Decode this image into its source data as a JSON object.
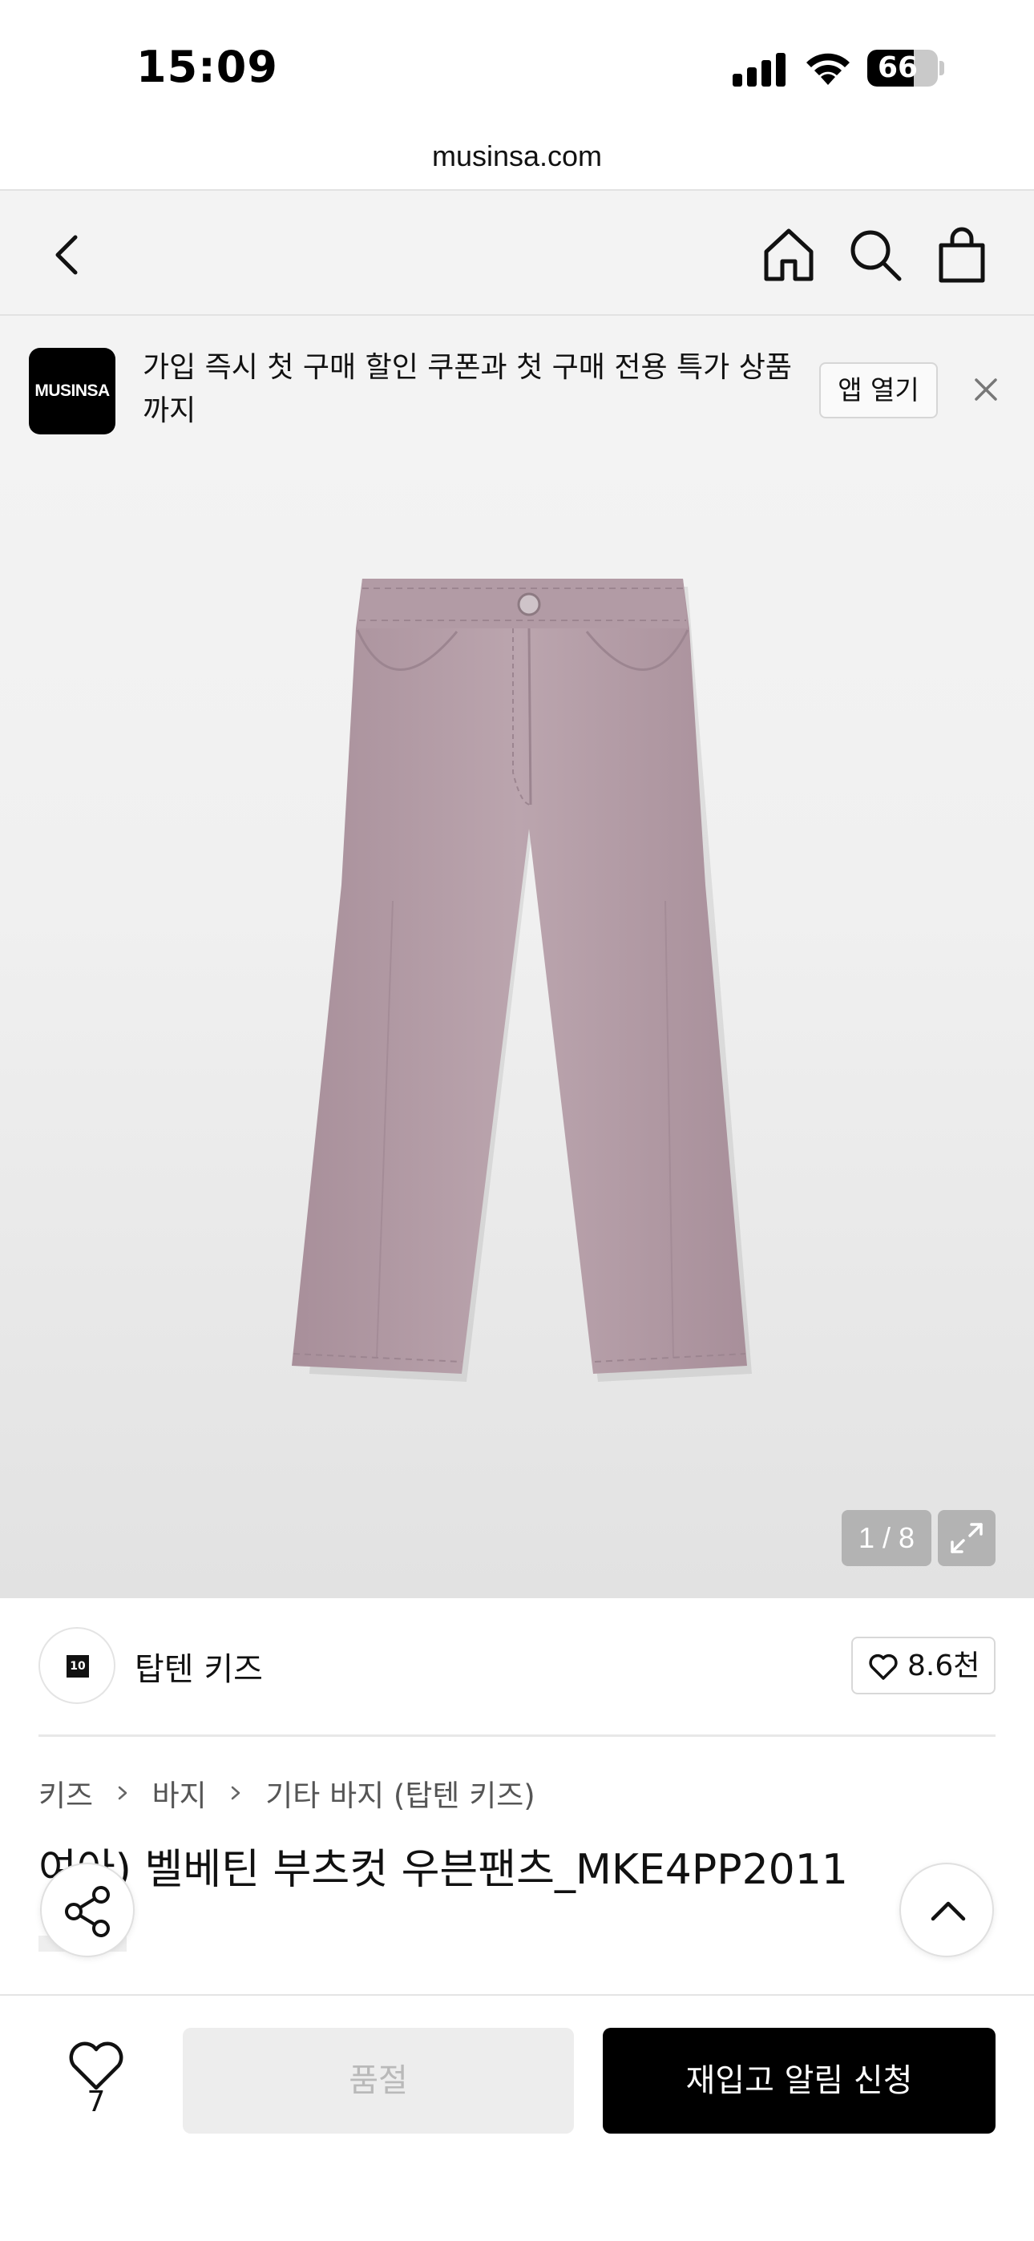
{
  "status_bar": {
    "time": "15:09",
    "battery": "66",
    "battery_level": 0.66
  },
  "browser": {
    "url": "musinsa.com"
  },
  "nav": {
    "back_icon": "chevron-left-icon",
    "home_icon": "home-icon",
    "search_icon": "search-icon",
    "cart_icon": "shopping-bag-icon"
  },
  "banner": {
    "logo_text": "MUSINSA",
    "message": "가입 즉시 첫 구매 할인 쿠폰과 첫 구매 전용 특가 상품까지",
    "open_app_label": "앱 열기",
    "close_icon": "close-icon"
  },
  "gallery": {
    "counter": "1 / 8",
    "expand_icon": "expand-icon"
  },
  "brand": {
    "logo_text": "10",
    "name": "탑텐 키즈",
    "likes": "8.6천"
  },
  "breadcrumb": {
    "items": [
      "키즈",
      "바지",
      "기타 바지 (탑텐 키즈)"
    ]
  },
  "product": {
    "title": "여아) 벨베틴 부츠컷 우븐팬츠_MKE4PP2011"
  },
  "bottom": {
    "wish_count": "7",
    "soldout_label": "품절",
    "restock_label": "재입고 알림 신청"
  },
  "colors": {
    "accent": "#000000",
    "pants": "#b39ca6"
  }
}
